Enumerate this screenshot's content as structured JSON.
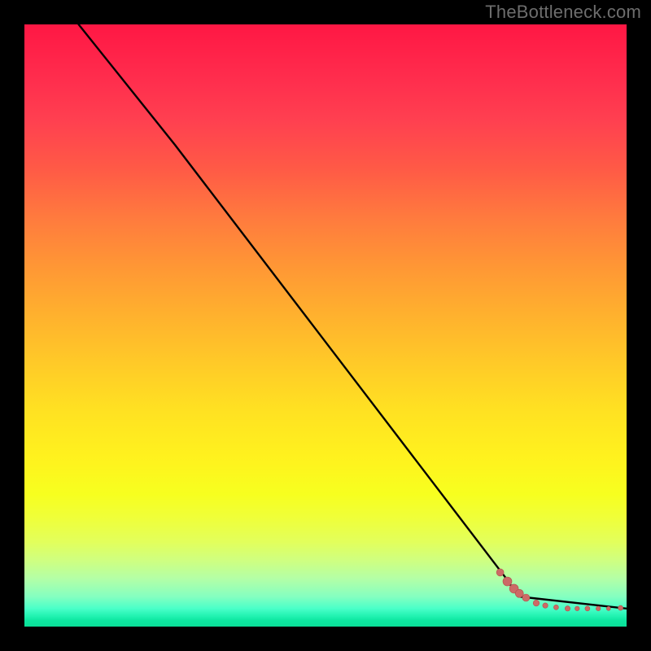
{
  "watermark": "TheBottleneck.com",
  "colors": {
    "line": "#000000",
    "marker_fill": "#cc6a66",
    "marker_stroke": "#b44f4c",
    "background": "#000000"
  },
  "chart_data": {
    "type": "line",
    "title": "",
    "xlabel": "",
    "ylabel": "",
    "xlim": [
      0,
      100
    ],
    "ylim": [
      0,
      100
    ],
    "grid": false,
    "legend": false,
    "series": [
      {
        "name": "bottleneck-curve",
        "type": "line",
        "x": [
          9,
          25,
          80,
          82,
          100
        ],
        "y": [
          100,
          80,
          8,
          5,
          3
        ]
      },
      {
        "name": "data-points",
        "type": "scatter",
        "points": [
          {
            "x": 79.0,
            "y": 9.0,
            "r": 4.5
          },
          {
            "x": 80.2,
            "y": 7.5,
            "r": 5.5
          },
          {
            "x": 81.3,
            "y": 6.3,
            "r": 5.5
          },
          {
            "x": 82.2,
            "y": 5.5,
            "r": 5.0
          },
          {
            "x": 83.3,
            "y": 4.8,
            "r": 4.5
          },
          {
            "x": 85.0,
            "y": 3.9,
            "r": 3.8
          },
          {
            "x": 86.5,
            "y": 3.5,
            "r": 3.2
          },
          {
            "x": 88.3,
            "y": 3.2,
            "r": 3.0
          },
          {
            "x": 90.2,
            "y": 3.0,
            "r": 3.2
          },
          {
            "x": 91.8,
            "y": 3.0,
            "r": 2.8
          },
          {
            "x": 93.5,
            "y": 3.0,
            "r": 3.0
          },
          {
            "x": 95.3,
            "y": 3.0,
            "r": 2.8
          },
          {
            "x": 97.0,
            "y": 3.0,
            "r": 2.5
          },
          {
            "x": 99.0,
            "y": 3.1,
            "r": 3.0
          }
        ]
      }
    ]
  }
}
